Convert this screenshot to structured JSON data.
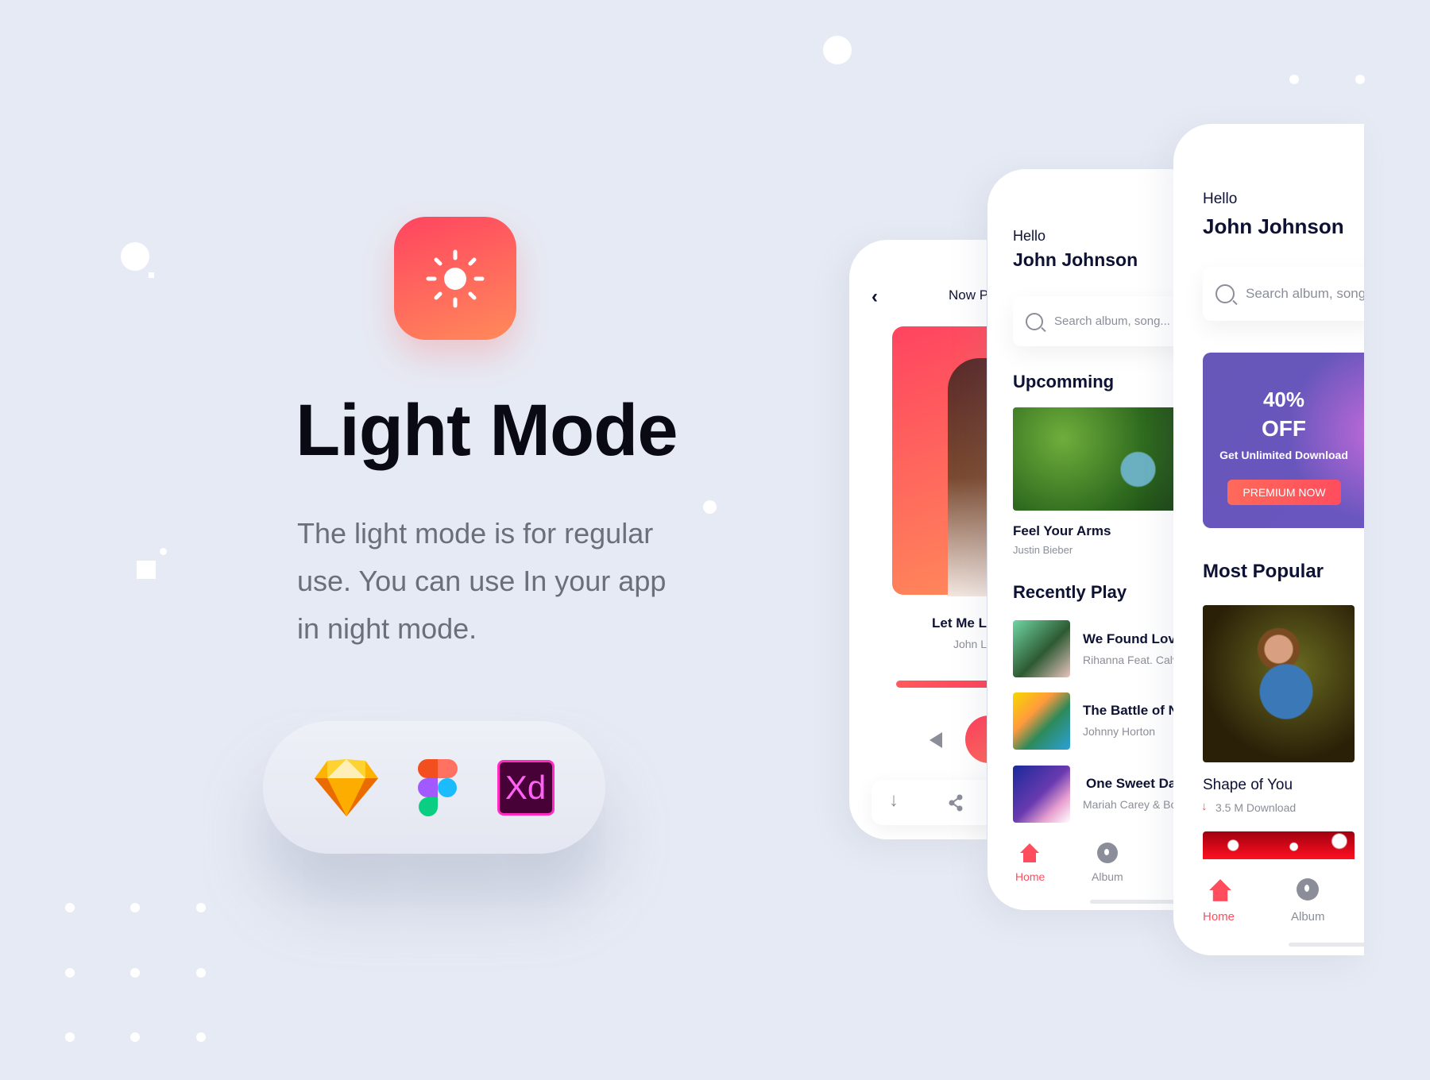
{
  "hero": {
    "title": "Light Mode",
    "description": "The light mode is for regular use. You can use In your app in night mode.",
    "icon": "sun-icon",
    "accent": "#ff4d5e"
  },
  "tools": [
    "sketch-logo",
    "figma-logo",
    "adobe-xd-logo"
  ],
  "tools_xd_text": "Xd",
  "now_playing": {
    "header": "Now P",
    "song": "Let Me L",
    "artist": "John L",
    "progress": 0.5
  },
  "home1": {
    "greeting": "Hello",
    "name": "John Johnson",
    "search_placeholder": "Search album, song...",
    "upcoming_title": "Upcomming",
    "upcoming": {
      "title": "Feel Your Arms",
      "artist": "Justin Bieber"
    },
    "recent_title": "Recently Play",
    "recent": [
      {
        "title": "We Found Love",
        "artist": "Rihanna Feat. Calvi"
      },
      {
        "title": "The Battle of Ne",
        "artist": "Johnny Horton"
      },
      {
        "title": "One Sweet Day",
        "artist": "Mariah Carey & Boy"
      }
    ],
    "nav": {
      "home": "Home",
      "album": "Album"
    }
  },
  "home2": {
    "greeting": "Hello",
    "name": "John Johnson",
    "search_placeholder": "Search album, song...",
    "promo": {
      "percent": "40%",
      "off": "OFF",
      "subtitle": "Get Unlimited Download",
      "button": "PREMIUM NOW"
    },
    "popular_title": "Most Popular",
    "popular": {
      "title": "Shape of You",
      "downloads": "3.5 M Download"
    },
    "nav": {
      "home": "Home",
      "album": "Album"
    }
  }
}
